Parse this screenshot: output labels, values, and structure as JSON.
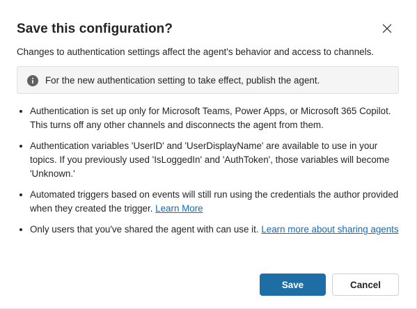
{
  "dialog": {
    "title": "Save this configuration?",
    "intro": "Changes to authentication settings affect the agent's behavior and access to channels.",
    "info_message": "For the new authentication setting to take effect, publish the agent.",
    "bullets": [
      {
        "text": "Authentication is set up only for Microsoft Teams, Power Apps, or Microsoft 365 Copilot. This turns off any other channels and disconnects the agent from them."
      },
      {
        "text": "Authentication variables 'UserID' and 'UserDisplayName' are available to use in your topics. If you previously used 'IsLoggedIn' and 'AuthToken', those variables will become 'Unknown.'"
      },
      {
        "text": "Automated triggers based on events will still run using the credentials the author provided when they created the trigger. ",
        "link": "Learn More"
      },
      {
        "text": "Only users that you've shared the agent with can use it. ",
        "link": "Learn more about sharing agents"
      }
    ],
    "buttons": {
      "save": "Save",
      "cancel": "Cancel"
    },
    "icons": {
      "close": "close-icon",
      "info": "info-icon"
    },
    "colors": {
      "primary_button": "#1c6ea4",
      "link": "#0f6cbd",
      "info_background": "#f5f5f5"
    }
  }
}
